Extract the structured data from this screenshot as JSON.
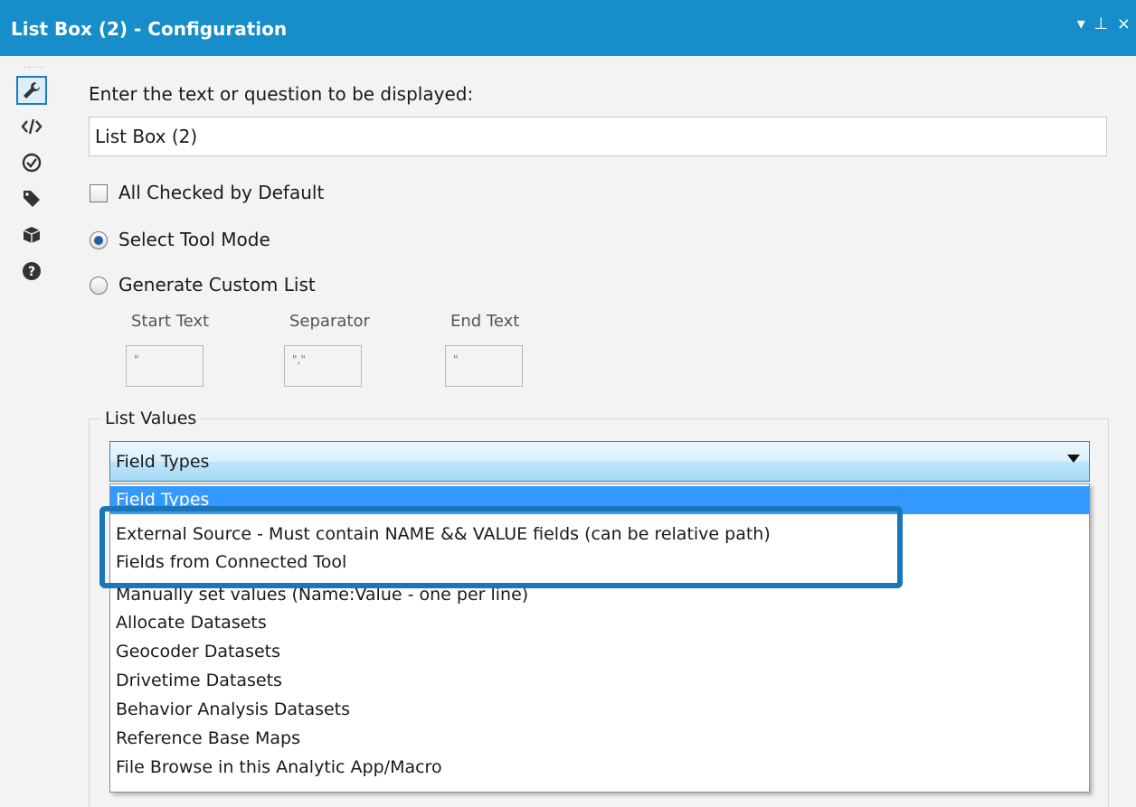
{
  "title": "List Box (2) - Configuration",
  "window_controls": {
    "menu": "▾",
    "pin": "⊥",
    "close": "×"
  },
  "sidebar": {
    "icons": [
      "wrench-icon",
      "code-icon",
      "target-icon",
      "tag-icon",
      "box-icon",
      "help-icon"
    ]
  },
  "form": {
    "prompt_label": "Enter the text or question to be displayed:",
    "prompt_value": "List Box (2)",
    "all_checked_label": "All Checked by Default",
    "all_checked": false,
    "select_tool_mode_label": "Select Tool Mode",
    "generate_custom_list_label": "Generate Custom List",
    "selected_mode": "Select Tool Mode",
    "start_text_label": "Start Text",
    "start_text_value": "\"",
    "separator_label": "Separator",
    "separator_value": "\",\"",
    "end_text_label": "End Text",
    "end_text_value": "\""
  },
  "list_values": {
    "group_label": "List Values",
    "selected": "Field Types",
    "options": [
      "Field Types",
      "External Source - Must contain NAME && VALUE fields  (can be relative path)",
      "Fields from Connected Tool",
      "Manually set values (Name:Value - one per line)",
      "Allocate Datasets",
      "Geocoder Datasets",
      "Drivetime Datasets",
      "Behavior Analysis Datasets",
      "Reference Base Maps",
      "File Browse in this Analytic App/Macro"
    ]
  },
  "colors": {
    "titlebar": "#178ec9",
    "highlight_border": "#1a76b9",
    "selected_option": "#3399ff"
  }
}
